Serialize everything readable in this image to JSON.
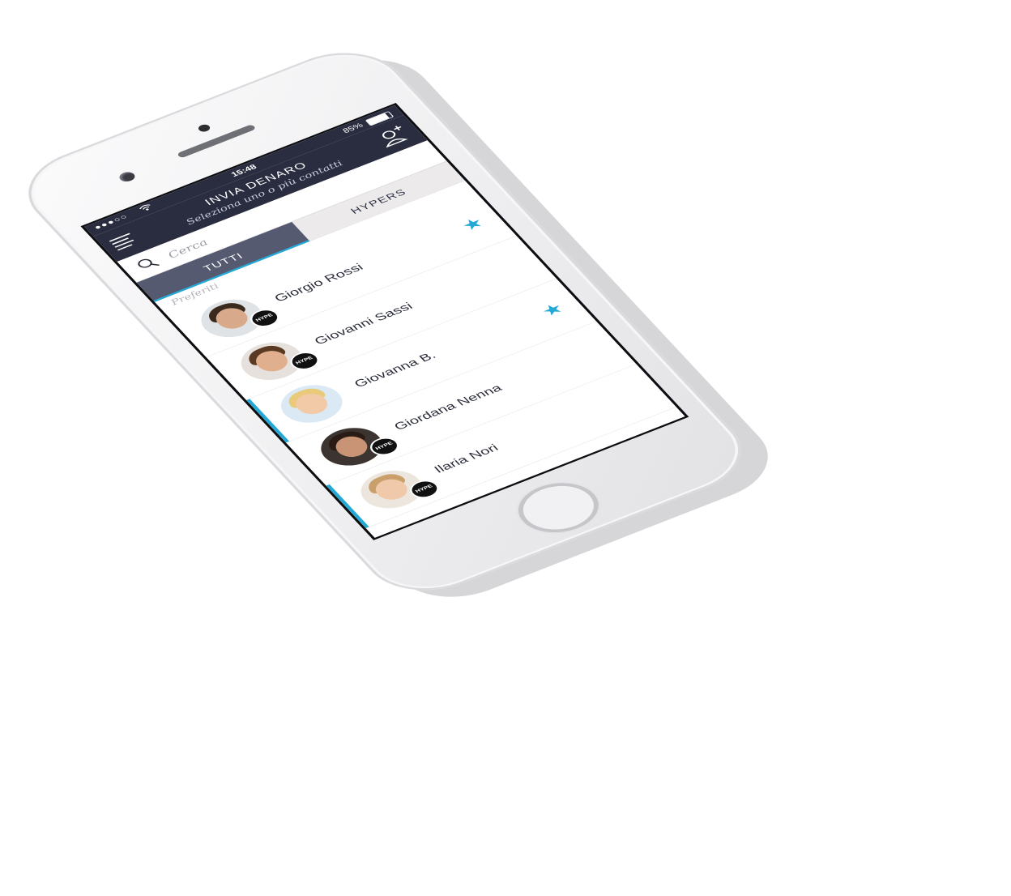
{
  "status_bar": {
    "signal": "●●●○○",
    "time": "15:48",
    "battery_percent": "85%",
    "battery_level": 0.85,
    "wifi_icon": "wifi-icon"
  },
  "nav": {
    "title": "INVIA DENARO",
    "subtitle": "Seleziona uno o più contatti",
    "menu_icon": "menu-icon",
    "add_contact_icon": "add-contact-icon"
  },
  "search": {
    "placeholder": "Cerca",
    "value": ""
  },
  "tabs": [
    {
      "label": "TUTTI",
      "active": true
    },
    {
      "label": "HYPERS",
      "active": false
    }
  ],
  "section": {
    "label": "Preferiti"
  },
  "contacts": [
    {
      "name": "Giorgio Rossi",
      "badge": "HYPE",
      "favorite": true,
      "selected": false
    },
    {
      "name": "Giovanni Sassi",
      "badge": "HYPE",
      "favorite": false,
      "selected": false
    },
    {
      "name": "Giovanna B.",
      "badge": "",
      "favorite": true,
      "selected": true
    },
    {
      "name": "Giordana Nenna",
      "badge": "HYPE",
      "favorite": false,
      "selected": false
    },
    {
      "name": "Ilaria Nori",
      "badge": "HYPE",
      "favorite": false,
      "selected": true
    }
  ],
  "colors": {
    "nav_background": "#2a2c40",
    "tab_background": "#565a70",
    "accent": "#24a9d7",
    "phone_body": "#eeeef0"
  }
}
